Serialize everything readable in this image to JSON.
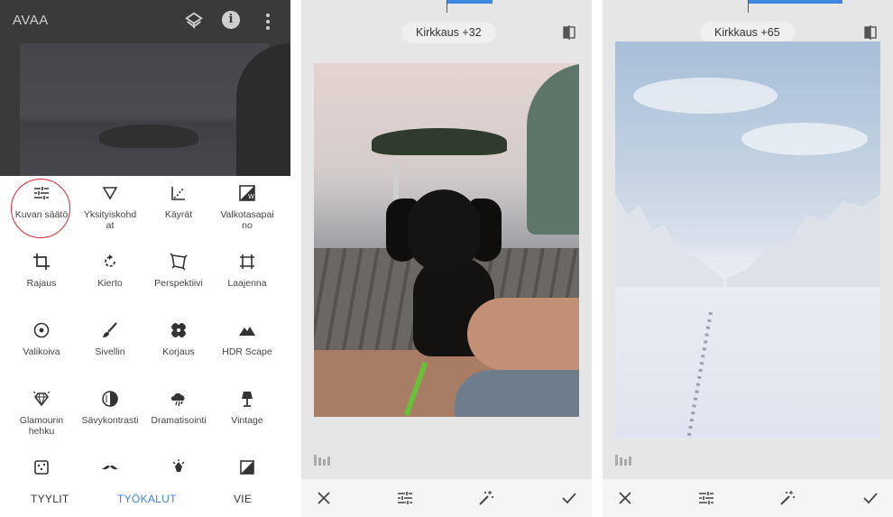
{
  "panel1": {
    "app_title": "AVAA",
    "top_icons": {
      "layers": "layers-icon",
      "info": "i",
      "menu": "more-vert-icon"
    },
    "tools": [
      {
        "label": "Kuvan säätö",
        "icon": "tune-icon"
      },
      {
        "label": "Yksityiskohdat",
        "icon": "details-triangle-icon"
      },
      {
        "label": "Käyrät",
        "icon": "curves-icon"
      },
      {
        "label": "Valkotasapaino",
        "icon": "white-balance-icon"
      },
      {
        "label": "Rajaus",
        "icon": "crop-icon"
      },
      {
        "label": "Kierto",
        "icon": "rotate-icon"
      },
      {
        "label": "Perspektiivi",
        "icon": "perspective-icon"
      },
      {
        "label": "Laajenna",
        "icon": "expand-icon"
      },
      {
        "label": "Valikoiva",
        "icon": "selective-icon"
      },
      {
        "label": "Sivellin",
        "icon": "brush-icon"
      },
      {
        "label": "Korjaus",
        "icon": "healing-icon"
      },
      {
        "label": "HDR Scape",
        "icon": "mountains-icon"
      },
      {
        "label": "Glamourin hehku",
        "icon": "diamond-icon"
      },
      {
        "label": "Sävykontrasti",
        "icon": "tonal-contrast-icon"
      },
      {
        "label": "Dramatisointi",
        "icon": "cloud-icon"
      },
      {
        "label": "Vintage",
        "icon": "lamp-icon"
      },
      {
        "label": "",
        "icon": "grunge-icon"
      },
      {
        "label": "",
        "icon": "mustache-icon"
      },
      {
        "label": "",
        "icon": "retrolux-icon"
      },
      {
        "label": "",
        "icon": "noir-icon"
      }
    ],
    "tool_labels_display": {
      "yksityiskohdat": [
        "Yksityiskohd",
        "at"
      ],
      "valkotasapaino": [
        "Valkotasapai",
        "no"
      ],
      "glamourin": [
        "Glamourin",
        "hehku"
      ]
    },
    "highlight_color": "#e0222c",
    "bottom_tabs": {
      "styles": "TYYLIT",
      "tools": "TYÖKALUT",
      "export": "VIE"
    },
    "active_tab_color": "#3b84e0"
  },
  "panel2": {
    "adjustment": "Kirkkaus +32",
    "brightness_value": 32
  },
  "panel3": {
    "adjustment": "Kirkkaus +65",
    "brightness_value": 65
  },
  "editor_icons": {
    "cancel": "close-icon",
    "adjust": "tune-icon",
    "auto": "magic-wand-icon",
    "apply": "check-icon",
    "compare": "compare-icon",
    "histogram": "histogram-icon"
  },
  "accent_color": "#3b84e0"
}
